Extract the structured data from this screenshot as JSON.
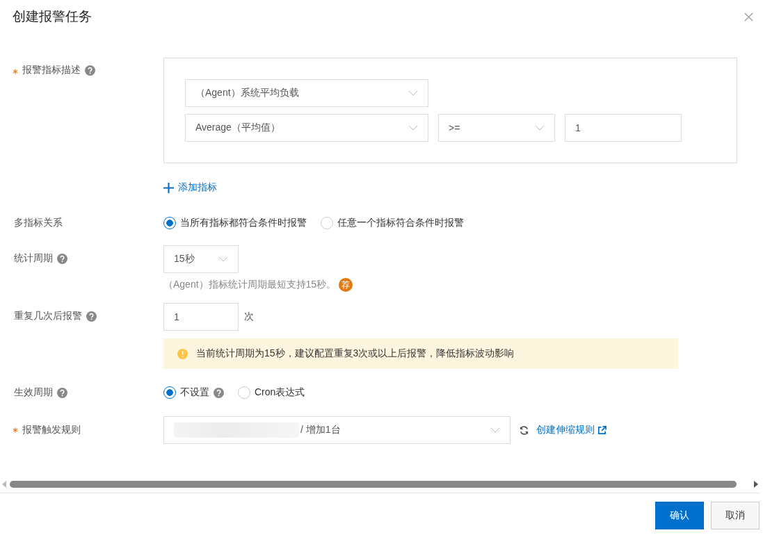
{
  "dialog": {
    "title": "创建报警任务"
  },
  "form": {
    "metric": {
      "label": "报警指标描述",
      "required": true,
      "help": true,
      "metric_select": "（Agent）系统平均负载",
      "stat_select": "Average（平均值）",
      "operator_select": ">=",
      "threshold": "1",
      "add_link": "添加指标"
    },
    "relation": {
      "label": "多指标关系",
      "options": [
        {
          "label": "当所有指标都符合条件时报警",
          "selected": true
        },
        {
          "label": "任意一个指标符合条件时报警",
          "selected": false
        }
      ]
    },
    "period": {
      "label": "统计周期",
      "help": true,
      "value": "15秒",
      "hint": "（Agent）指标统计周期最短支持15秒。",
      "badge": "荐"
    },
    "repeat": {
      "label": "重复几次后报警",
      "help": true,
      "value": "1",
      "unit": "次",
      "notice": "当前统计周期为15秒，建议配置重复3次或以上后报警，降低指标波动影响"
    },
    "effective": {
      "label": "生效周期",
      "help": true,
      "options": [
        {
          "label": "不设置",
          "selected": true,
          "help": true
        },
        {
          "label": "Cron表达式",
          "selected": false,
          "help": false
        }
      ]
    },
    "rule": {
      "label": "报警触发规则",
      "required": true,
      "value": "/ 增加1台",
      "link": "创建伸缩规则"
    }
  },
  "buttons": [
    {
      "label": "确认",
      "kind": "primary"
    },
    {
      "label": "取消",
      "kind": "secondary"
    }
  ]
}
